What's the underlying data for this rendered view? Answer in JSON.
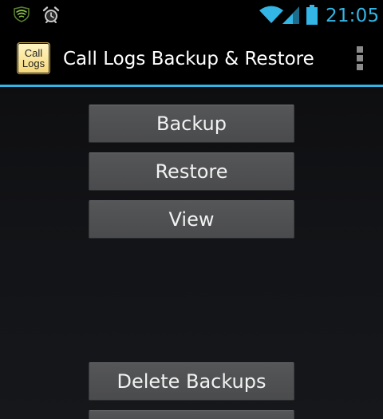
{
  "status_bar": {
    "time": "21:05",
    "icons": [
      "shield-icon",
      "alarm-icon",
      "wifi-icon",
      "signal-icon",
      "battery-icon"
    ],
    "accent_color": "#33b5e5"
  },
  "action_bar": {
    "app_icon_line1": "Call",
    "app_icon_line2": "Logs",
    "title": "Call Logs Backup & Restore",
    "menu_icon": "overflow-menu-icon",
    "divider_color": "#33b5e5"
  },
  "buttons": {
    "backup": "Backup",
    "restore": "Restore",
    "view": "View",
    "delete_backups": "Delete Backups"
  }
}
